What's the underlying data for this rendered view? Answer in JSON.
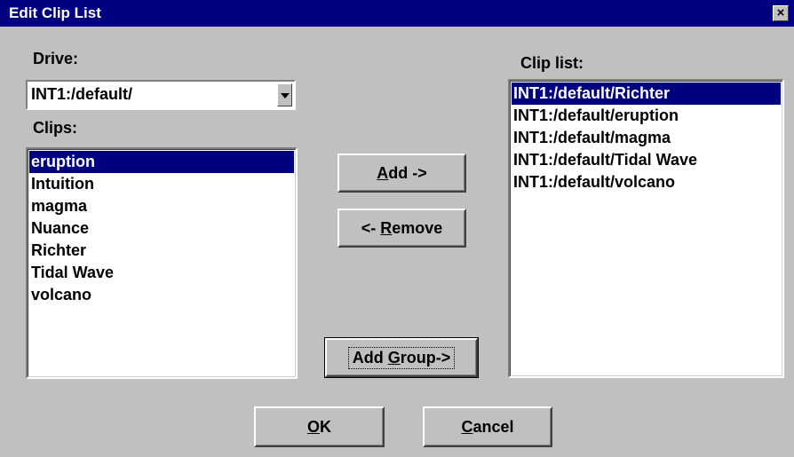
{
  "window": {
    "title": "Edit Clip List",
    "close_glyph": "×"
  },
  "drive": {
    "label": "Drive:",
    "value": "INT1:/default/"
  },
  "clips": {
    "label": "Clips:",
    "items": [
      "eruption",
      "Intuition",
      "magma",
      "Nuance",
      "Richter",
      "Tidal Wave",
      "volcano"
    ],
    "selected": "eruption"
  },
  "clip_list": {
    "label": "Clip list:",
    "items": [
      "INT1:/default/Richter",
      "INT1:/default/eruption",
      "INT1:/default/magma",
      "INT1:/default/Tidal Wave",
      "INT1:/default/volcano"
    ],
    "selected": "INT1:/default/Richter"
  },
  "buttons": {
    "add": {
      "pre": "",
      "mnemonic": "A",
      "post": "dd ->"
    },
    "remove": {
      "pre": "<- ",
      "mnemonic": "R",
      "post": "emove"
    },
    "add_group": {
      "pre": "Add ",
      "mnemonic": "G",
      "post": "roup->"
    },
    "ok": {
      "pre": "",
      "mnemonic": "O",
      "post": "K"
    },
    "cancel": {
      "pre": "",
      "mnemonic": "C",
      "post": "ancel"
    }
  },
  "colors": {
    "selection": "#000080",
    "face": "#c0c0c0"
  },
  "icons": {
    "dropdown": "chevron-down-icon",
    "close": "close-icon"
  }
}
